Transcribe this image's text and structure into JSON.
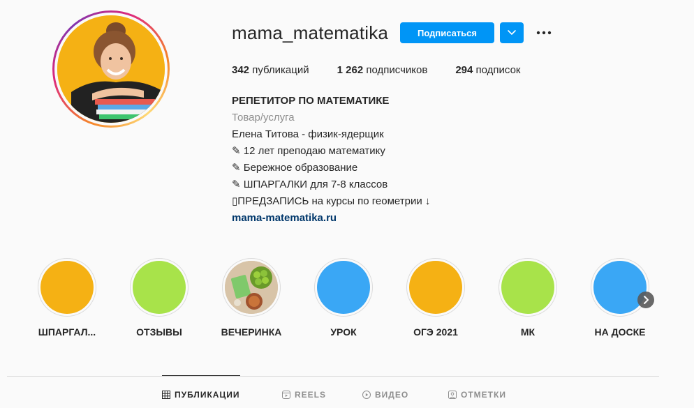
{
  "profile": {
    "username": "mama_matematika",
    "follow_label": "Подписаться",
    "avatar_bg": "#f5b114"
  },
  "stats": {
    "posts_count": "342",
    "posts_label": "публикаций",
    "followers_count": "1 262",
    "followers_label": "подписчиков",
    "following_count": "294",
    "following_label": "подписок"
  },
  "bio": {
    "title": "РЕПЕТИТОР ПО МАТЕМАТИКЕ",
    "category": "Товар/услуга",
    "lines": [
      "Елена Титова - физик-ядерщик",
      "✎ 12 лет преподаю математику",
      "✎ Бережное образование",
      "✎ ШПАРГАЛКИ для 7-8 классов",
      "▯ПРЕДЗАПИСЬ на курсы по геометрии ↓"
    ],
    "link": "mama-matematika.ru"
  },
  "highlights": [
    {
      "label": "ШПАРГАЛ...",
      "color": "#f5b114"
    },
    {
      "label": "ОТЗЫВЫ",
      "color": "#a8e34a"
    },
    {
      "label": "ВЕЧЕРИНКА",
      "color": "#d8c4a8"
    },
    {
      "label": "УРОК",
      "color": "#3aa7f5"
    },
    {
      "label": "ОГЭ 2021",
      "color": "#f5b114"
    },
    {
      "label": "МК",
      "color": "#a8e34a"
    },
    {
      "label": "НА ДОСКЕ",
      "color": "#3aa7f5"
    }
  ],
  "tabs": [
    {
      "label": "ПУБЛИКАЦИИ",
      "icon": "grid-icon",
      "active": true
    },
    {
      "label": "REELS",
      "icon": "reels-icon"
    },
    {
      "label": "ВИДЕО",
      "icon": "video-icon"
    },
    {
      "label": "ОТМЕТКИ",
      "icon": "tagged-icon"
    }
  ],
  "colors": {
    "accent": "#0095f6",
    "link": "#00376b",
    "muted": "#8e8e8e"
  }
}
